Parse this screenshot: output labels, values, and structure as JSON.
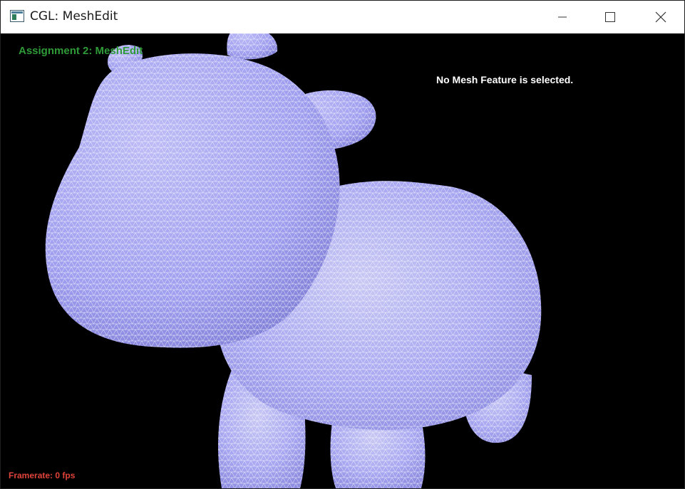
{
  "window": {
    "title": "CGL: MeshEdit",
    "icons": {
      "app": "app-window-icon",
      "minimize": "minimize-icon",
      "maximize": "maximize-icon",
      "close": "close-icon"
    }
  },
  "viewport": {
    "assignment_label": "Assignment 2: MeshEdit",
    "selection_status": "No Mesh Feature is selected.",
    "framerate_label": "Framerate: 0 fps",
    "background_color": "#000000",
    "mesh_fill_color": "#a9a8f2",
    "wireframe_color": "#ffffff"
  }
}
